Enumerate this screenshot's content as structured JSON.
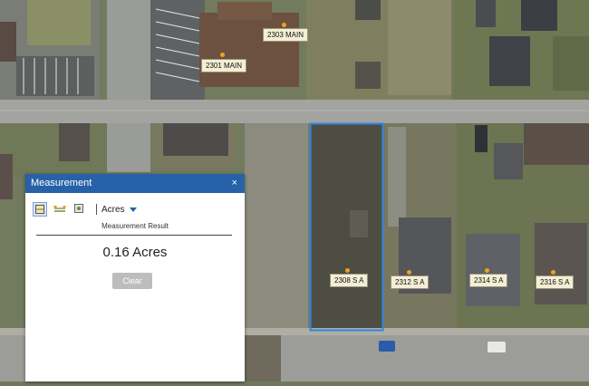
{
  "map": {
    "parcel_labels": [
      {
        "id": "2303-main",
        "text": "2303 MAIN"
      },
      {
        "id": "2301-main",
        "text": "2301 MAIN"
      },
      {
        "id": "2308-s-a",
        "text": "2308 S A"
      },
      {
        "id": "2312-s-a",
        "text": "2312 S A"
      },
      {
        "id": "2314-s-a",
        "text": "2314 S A"
      },
      {
        "id": "2316-s-a",
        "text": "2316 S A"
      }
    ],
    "highlight_color": "#2f86e0"
  },
  "measurement": {
    "title": "Measurement",
    "close_glyph": "×",
    "tools": [
      {
        "name": "area-tool-icon",
        "selected": true
      },
      {
        "name": "distance-tool-icon",
        "selected": false
      },
      {
        "name": "location-tool-icon",
        "selected": false
      }
    ],
    "unit": "Acres",
    "result_label": "Measurement Result",
    "result_value": "0.16 Acres",
    "clear_label": "Clear"
  }
}
